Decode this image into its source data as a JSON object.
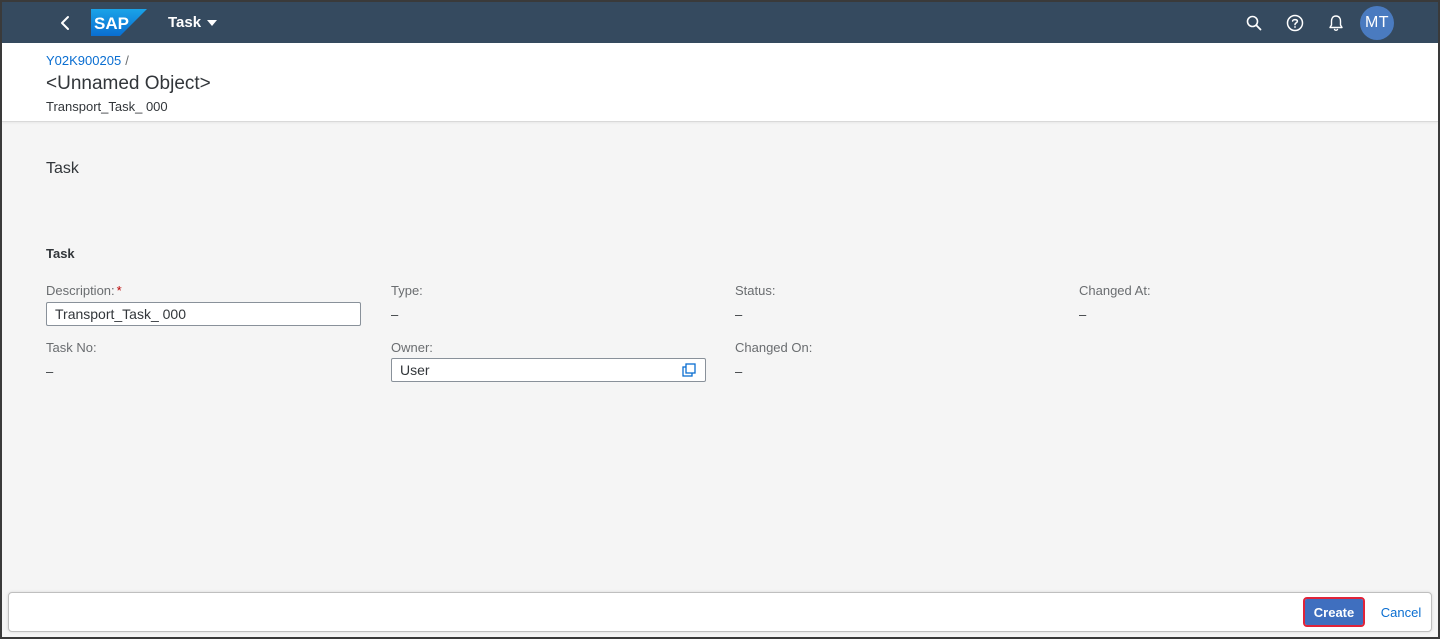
{
  "shell": {
    "logo_text": "SAP",
    "app_title": "Task",
    "avatar_initials": "MT",
    "colors": {
      "shell_bg": "#354a5f",
      "avatar_bg": "#4a7bc0"
    }
  },
  "header": {
    "breadcrumb_link": "Y02K900205",
    "breadcrumb_sep": "/",
    "title": "<Unnamed Object>",
    "subtitle": "Transport_Task_ 000"
  },
  "section": {
    "title": "Task",
    "group_title": "Task"
  },
  "fields": {
    "description": {
      "label": "Description:",
      "required_mark": "*",
      "value": "Transport_Task_ 000"
    },
    "type": {
      "label": "Type:",
      "value": "–"
    },
    "status": {
      "label": "Status:",
      "value": "–"
    },
    "changed_at": {
      "label": "Changed At:",
      "value": "–"
    },
    "task_no": {
      "label": "Task No:",
      "value": "–"
    },
    "owner": {
      "label": "Owner:",
      "value": "User"
    },
    "changed_on": {
      "label": "Changed On:",
      "value": "–"
    }
  },
  "footer": {
    "create_label": "Create",
    "cancel_label": "Cancel"
  },
  "icons": {
    "back": "chevron-left-icon",
    "search": "search-icon",
    "help": "help-icon",
    "notifications": "bell-icon",
    "value_help": "value-help-icon"
  }
}
